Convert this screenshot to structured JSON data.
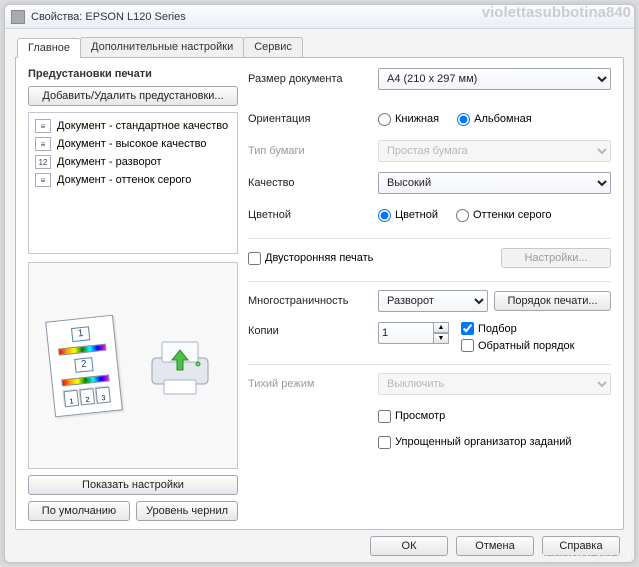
{
  "watermarks": {
    "top": "violettasubbotina840",
    "bottom": "IRECOMMEND.RU"
  },
  "titlebar": {
    "icon": "printer-icon",
    "title": "Свойства: EPSON L120 Series"
  },
  "tabs": {
    "main": "Главное",
    "advanced": "Дополнительные настройки",
    "service": "Сервис",
    "active": "main"
  },
  "presets": {
    "heading": "Предустановки печати",
    "add_remove_button": "Добавить/Удалить предустановки...",
    "items": [
      {
        "icon": "doc-std",
        "label": "Документ - стандартное качество"
      },
      {
        "icon": "doc-hq",
        "label": "Документ - высокое качество"
      },
      {
        "icon": "doc-spread",
        "label": "Документ - разворот"
      },
      {
        "icon": "doc-gray",
        "label": "Документ - оттенок серого"
      }
    ]
  },
  "bottom_left": {
    "show_settings": "Показать настройки",
    "defaults": "По умолчанию",
    "ink_level": "Уровень чернил"
  },
  "form": {
    "doc_size": {
      "label": "Размер документа",
      "value": "A4 (210 x 297 мм)"
    },
    "orientation": {
      "label": "Ориентация",
      "portrait": "Книжная",
      "landscape": "Альбомная",
      "selected": "landscape"
    },
    "paper_type": {
      "label": "Тип бумаги",
      "value": "Простая бумага",
      "disabled": true
    },
    "quality": {
      "label": "Качество",
      "value": "Высокий"
    },
    "color": {
      "label": "Цветной",
      "color_opt": "Цветной",
      "gray_opt": "Оттенки серого",
      "selected": "color"
    },
    "duplex": {
      "label": "Двусторонняя печать",
      "checked": false,
      "settings_btn": "Настройки...",
      "settings_disabled": true
    },
    "multipage": {
      "label": "Многостраничность",
      "value": "Разворот",
      "order_btn": "Порядок печати..."
    },
    "copies": {
      "label": "Копии",
      "value": "1",
      "collate": "Подбор",
      "collate_checked": true,
      "reverse": "Обратный порядок",
      "reverse_checked": false
    },
    "quiet": {
      "label": "Тихий режим",
      "value": "Выключить",
      "disabled": true
    },
    "preview": {
      "label": "Просмотр",
      "checked": false
    },
    "simple_org": {
      "label": "Упрощенный организатор заданий",
      "checked": false
    }
  },
  "footer": {
    "ok": "ОК",
    "cancel": "Отмена",
    "help": "Справка"
  },
  "preview_icons": {
    "page1": "1",
    "page2": "2",
    "tiny1": "1",
    "tiny2": "2",
    "tiny3": "3"
  }
}
